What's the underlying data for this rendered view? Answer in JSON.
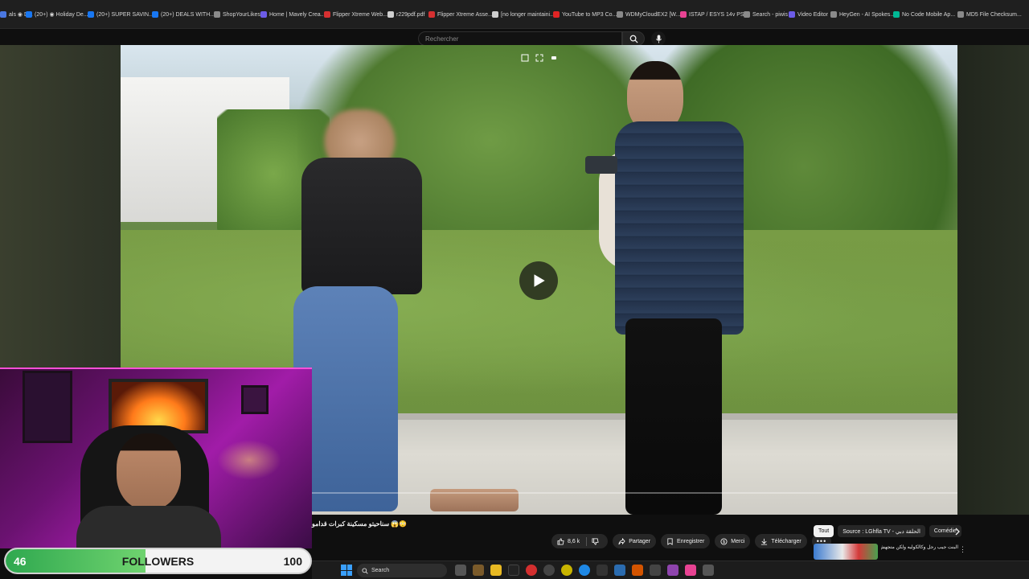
{
  "bookmarks": [
    {
      "label": "als ◉ D...",
      "color": "#4a77e0"
    },
    {
      "label": "(20+) ◉ Holiday De...",
      "color": "#1877f2"
    },
    {
      "label": "(20+) SUPER SAVIN...",
      "color": "#1877f2"
    },
    {
      "label": "(20+) DEALS WITH...",
      "color": "#1877f2"
    },
    {
      "label": "ShopYourLikes",
      "color": "#8a8a8a"
    },
    {
      "label": "Home | Mavely Crea...",
      "color": "#6c5ce7"
    },
    {
      "label": "Flipper Xtreme Web...",
      "color": "#d63031"
    },
    {
      "label": "r229pdf.pdf",
      "color": "#cfcfcf"
    },
    {
      "label": "Flipper Xtreme Asse...",
      "color": "#d63031"
    },
    {
      "label": "[no longer maintaini...",
      "color": "#cfcfcf"
    },
    {
      "label": "YouTube to MP3 Co...",
      "color": "#e02424"
    },
    {
      "label": "WDMyCloudEX2 [W...",
      "color": "#8a8a8a"
    },
    {
      "label": "ISTAP / ESYS 14v PS...",
      "color": "#e84393"
    },
    {
      "label": "Search - piwis",
      "color": "#8a8a8a"
    },
    {
      "label": "Video Editor",
      "color": "#6c5ce7"
    },
    {
      "label": "HeyGen - AI Spokes...",
      "color": "#8a8a8a"
    },
    {
      "label": "No Code Mobile Ap...",
      "color": "#00b894"
    },
    {
      "label": "MD5 File Checksum...",
      "color": "#8a8a8a"
    }
  ],
  "search": {
    "placeholder": "Rechercher"
  },
  "followers": {
    "current": "46",
    "label": "FOLLOWERS",
    "goal": "100",
    "progress_fraction": 0.46
  },
  "video": {
    "title": "سناحيتو مسكينة كبرات قدامو 😱😳",
    "progress_fraction": 0.0
  },
  "actions": {
    "likes": "8,6 k",
    "share": "Partager",
    "save": "Enregistrer",
    "thanks": "Merci",
    "download": "Télécharger"
  },
  "chips": [
    "Tout",
    "Source : LGhfla TV - الحلقة دبي",
    "Comédie"
  ],
  "recommendation": {
    "title": "البنت جيب رجل وكالكوليه ولكن متجهش لحلقتك"
  },
  "taskbar": {
    "search_label": "Search"
  },
  "colors": {
    "accent_green": "#2fa84f",
    "youtube_bg": "#0f0f0f",
    "webcam_border": "#ff4fd8"
  }
}
